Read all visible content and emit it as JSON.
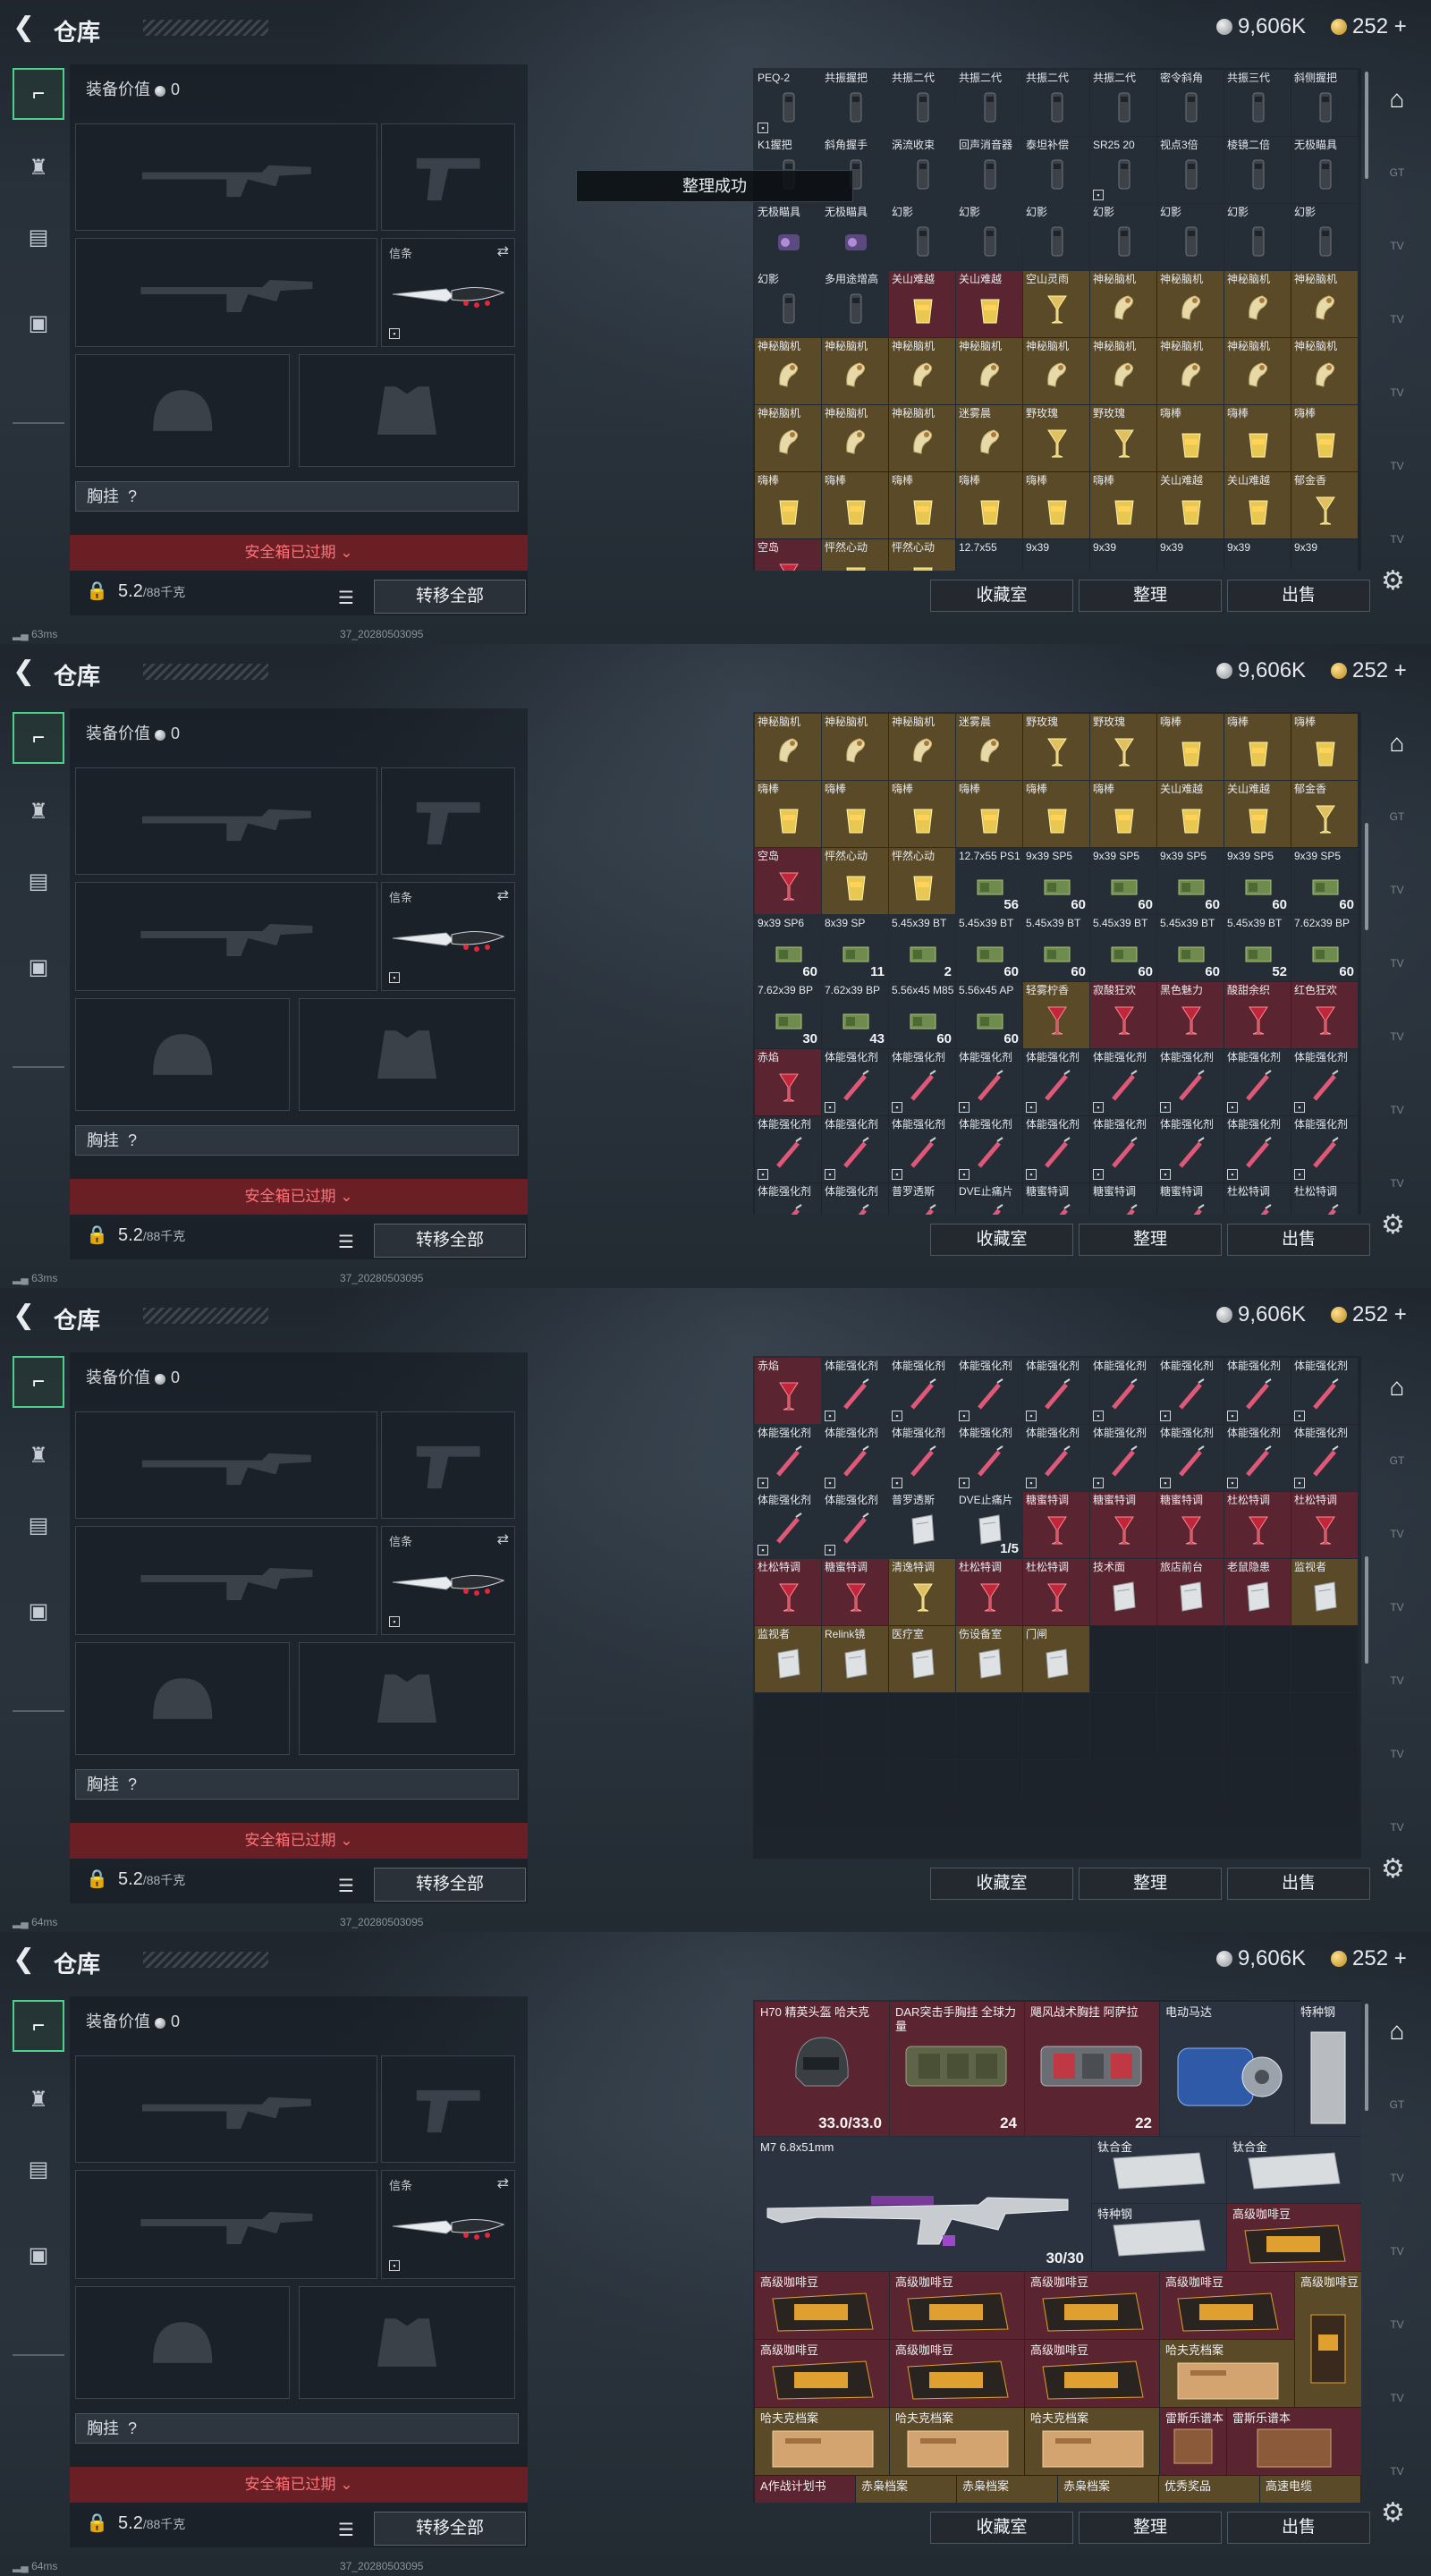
{
  "header": {
    "title": "仓库",
    "silver": "9,606K",
    "gold": "252"
  },
  "equip": {
    "value_label": "装备价值",
    "value": "0",
    "melee_label": "信条",
    "chest_label": "胸挂",
    "chest_value": "?",
    "safe_text": "安全箱已过期",
    "weight_value": "5.2",
    "weight_cap": "/88千克",
    "transfer_label": "转移全部"
  },
  "buttons": {
    "collection": "收藏室",
    "sort": "整理",
    "sell": "出售"
  },
  "toast": "整理成功",
  "status": {
    "ping1": "63ms",
    "ping2": "63ms",
    "ping3": "64ms",
    "ping4": "64ms",
    "ver": "37_20280503095"
  },
  "screens": [
    {
      "items": [
        {
          "n": "PEQ-2",
          "k": "att",
          "l": 1
        },
        {
          "n": "共振握把",
          "k": "att"
        },
        {
          "n": "共振二代",
          "k": "att"
        },
        {
          "n": "共振二代",
          "k": "att"
        },
        {
          "n": "共振二代",
          "k": "att"
        },
        {
          "n": "共振二代",
          "k": "att"
        },
        {
          "n": "密令斜角",
          "k": "att"
        },
        {
          "n": "共振三代",
          "k": "att"
        },
        {
          "n": "斜侧握把",
          "k": "att"
        },
        {
          "n": "K1握把",
          "k": "att"
        },
        {
          "n": "斜角握手",
          "k": "att"
        },
        {
          "n": "涡流收束",
          "k": "att"
        },
        {
          "n": "回声消音器",
          "k": "att"
        },
        {
          "n": "泰坦补偿",
          "k": "att"
        },
        {
          "n": "SR25 20",
          "k": "att",
          "l": 1
        },
        {
          "n": "视点3倍",
          "k": "att"
        },
        {
          "n": "棱镜二倍",
          "k": "att"
        },
        {
          "n": "无极瞄具",
          "k": "att"
        },
        {
          "n": "无极瞄具",
          "k": "pur"
        },
        {
          "n": "无极瞄具",
          "k": "pur"
        },
        {
          "n": "幻影",
          "k": "att"
        },
        {
          "n": "幻影",
          "k": "att"
        },
        {
          "n": "幻影",
          "k": "att"
        },
        {
          "n": "幻影",
          "k": "att"
        },
        {
          "n": "幻影",
          "k": "att"
        },
        {
          "n": "幻影",
          "k": "att"
        },
        {
          "n": "幻影",
          "k": "att"
        },
        {
          "n": "幻影",
          "k": "att"
        },
        {
          "n": "多用途增高",
          "k": "att"
        },
        {
          "n": "关山难越",
          "k": "drk",
          "b": "red"
        },
        {
          "n": "关山难越",
          "k": "drk",
          "b": "red"
        },
        {
          "n": "空山灵雨",
          "k": "cup",
          "b": "gold"
        },
        {
          "n": "神秘脑机",
          "k": "bio",
          "b": "gold"
        },
        {
          "n": "神秘脑机",
          "k": "bio",
          "b": "gold"
        },
        {
          "n": "神秘脑机",
          "k": "bio",
          "b": "gold"
        },
        {
          "n": "神秘脑机",
          "k": "bio",
          "b": "gold"
        },
        {
          "n": "神秘脑机",
          "k": "bio",
          "b": "gold"
        },
        {
          "n": "神秘脑机",
          "k": "bio",
          "b": "gold"
        },
        {
          "n": "神秘脑机",
          "k": "bio",
          "b": "gold"
        },
        {
          "n": "神秘脑机",
          "k": "bio",
          "b": "gold"
        },
        {
          "n": "神秘脑机",
          "k": "bio",
          "b": "gold"
        },
        {
          "n": "神秘脑机",
          "k": "bio",
          "b": "gold"
        },
        {
          "n": "神秘脑机",
          "k": "bio",
          "b": "gold"
        },
        {
          "n": "神秘脑机",
          "k": "bio",
          "b": "gold"
        },
        {
          "n": "神秘脑机",
          "k": "bio",
          "b": "gold"
        },
        {
          "n": "神秘脑机",
          "k": "bio",
          "b": "gold"
        },
        {
          "n": "神秘脑机",
          "k": "bio",
          "b": "gold"
        },
        {
          "n": "神秘脑机",
          "k": "bio",
          "b": "gold"
        },
        {
          "n": "迷雾晨",
          "k": "bio",
          "b": "gold"
        },
        {
          "n": "野玫瑰",
          "k": "cup",
          "b": "gold"
        },
        {
          "n": "野玫瑰",
          "k": "cup",
          "b": "gold"
        },
        {
          "n": "嗨棒",
          "k": "drk",
          "b": "gold"
        },
        {
          "n": "嗨棒",
          "k": "drk",
          "b": "gold"
        },
        {
          "n": "嗨棒",
          "k": "drk",
          "b": "gold"
        },
        {
          "n": "嗨棒",
          "k": "drk",
          "b": "gold"
        },
        {
          "n": "嗨棒",
          "k": "drk",
          "b": "gold"
        },
        {
          "n": "嗨棒",
          "k": "drk",
          "b": "gold"
        },
        {
          "n": "嗨棒",
          "k": "drk",
          "b": "gold"
        },
        {
          "n": "嗨棒",
          "k": "drk",
          "b": "gold"
        },
        {
          "n": "嗨棒",
          "k": "drk",
          "b": "gold"
        },
        {
          "n": "关山难越",
          "k": "drk",
          "b": "gold"
        },
        {
          "n": "关山难越",
          "k": "drk",
          "b": "gold"
        },
        {
          "n": "郁金香",
          "k": "cup",
          "b": "gold"
        },
        {
          "n": "空岛",
          "k": "red",
          "b": "red"
        },
        {
          "n": "怦然心动",
          "k": "drk",
          "b": "gold"
        },
        {
          "n": "怦然心动",
          "k": "drk",
          "b": "gold"
        },
        {
          "n": "12.7x55",
          "k": "amm"
        },
        {
          "n": "9x39",
          "k": "amm"
        },
        {
          "n": "9x39",
          "k": "amm"
        },
        {
          "n": "9x39",
          "k": "amm"
        },
        {
          "n": "9x39",
          "k": "amm"
        },
        {
          "n": "9x39",
          "k": "amm"
        }
      ]
    },
    {
      "items": [
        {
          "n": "神秘脑机",
          "k": "bio",
          "b": "gold"
        },
        {
          "n": "神秘脑机",
          "k": "bio",
          "b": "gold"
        },
        {
          "n": "神秘脑机",
          "k": "bio",
          "b": "gold"
        },
        {
          "n": "迷雾晨",
          "k": "bio",
          "b": "gold"
        },
        {
          "n": "野玫瑰",
          "k": "cup",
          "b": "gold"
        },
        {
          "n": "野玫瑰",
          "k": "cup",
          "b": "gold"
        },
        {
          "n": "嗨棒",
          "k": "drk",
          "b": "gold"
        },
        {
          "n": "嗨棒",
          "k": "drk",
          "b": "gold"
        },
        {
          "n": "嗨棒",
          "k": "drk",
          "b": "gold"
        },
        {
          "n": "嗨棒",
          "k": "drk",
          "b": "gold"
        },
        {
          "n": "嗨棒",
          "k": "drk",
          "b": "gold"
        },
        {
          "n": "嗨棒",
          "k": "drk",
          "b": "gold"
        },
        {
          "n": "嗨棒",
          "k": "drk",
          "b": "gold"
        },
        {
          "n": "嗨棒",
          "k": "drk",
          "b": "gold"
        },
        {
          "n": "嗨棒",
          "k": "drk",
          "b": "gold"
        },
        {
          "n": "关山难越",
          "k": "drk",
          "b": "gold"
        },
        {
          "n": "关山难越",
          "k": "drk",
          "b": "gold"
        },
        {
          "n": "郁金香",
          "k": "cup",
          "b": "gold"
        },
        {
          "n": "空岛",
          "k": "red",
          "b": "red"
        },
        {
          "n": "怦然心动",
          "k": "drk",
          "b": "gold"
        },
        {
          "n": "怦然心动",
          "k": "drk",
          "b": "gold"
        },
        {
          "n": "12.7x55 PS12A",
          "k": "amm",
          "c": "56"
        },
        {
          "n": "9x39 SP5",
          "k": "amm",
          "c": "60"
        },
        {
          "n": "9x39 SP5",
          "k": "amm",
          "c": "60"
        },
        {
          "n": "9x39 SP5",
          "k": "amm",
          "c": "60"
        },
        {
          "n": "9x39 SP5",
          "k": "amm",
          "c": "60"
        },
        {
          "n": "9x39 SP5",
          "k": "amm",
          "c": "60"
        },
        {
          "n": "9x39 SP6",
          "k": "amm",
          "c": "60"
        },
        {
          "n": "8x39 SP",
          "k": "amm",
          "c": "11"
        },
        {
          "n": "5.45x39 BT",
          "k": "amm",
          "c": "2"
        },
        {
          "n": "5.45x39 BT",
          "k": "amm",
          "c": "60"
        },
        {
          "n": "5.45x39 BT",
          "k": "amm",
          "c": "60"
        },
        {
          "n": "5.45x39 BT",
          "k": "amm",
          "c": "60"
        },
        {
          "n": "5.45x39 BT",
          "k": "amm",
          "c": "60"
        },
        {
          "n": "5.45x39 BT",
          "k": "amm",
          "c": "52"
        },
        {
          "n": "7.62x39 BP",
          "k": "amm",
          "c": "60"
        },
        {
          "n": "7.62x39 BP",
          "k": "amm",
          "c": "30"
        },
        {
          "n": "7.62x39 BP",
          "k": "amm",
          "c": "43"
        },
        {
          "n": "5.56x45 M855A1",
          "k": "amm",
          "c": "60"
        },
        {
          "n": "5.56x45 AP",
          "k": "amm",
          "c": "60"
        },
        {
          "n": "轻雾柠香",
          "k": "red",
          "b": "gold"
        },
        {
          "n": "寂酸狂欢",
          "k": "red",
          "b": "red"
        },
        {
          "n": "黑色魅力",
          "k": "red",
          "b": "red"
        },
        {
          "n": "酸甜余织",
          "k": "red",
          "b": "red"
        },
        {
          "n": "红色狂欢",
          "k": "red",
          "b": "red"
        },
        {
          "n": "赤焰",
          "k": "red",
          "b": "red"
        },
        {
          "n": "体能强化剂",
          "k": "syr"
        },
        {
          "n": "体能强化剂",
          "k": "syr"
        },
        {
          "n": "体能强化剂",
          "k": "syr"
        },
        {
          "n": "体能强化剂",
          "k": "syr"
        },
        {
          "n": "体能强化剂",
          "k": "syr"
        },
        {
          "n": "体能强化剂",
          "k": "syr"
        },
        {
          "n": "体能强化剂",
          "k": "syr"
        },
        {
          "n": "体能强化剂",
          "k": "syr"
        },
        {
          "n": "体能强化剂",
          "k": "syr"
        },
        {
          "n": "体能强化剂",
          "k": "syr"
        },
        {
          "n": "体能强化剂",
          "k": "syr"
        },
        {
          "n": "体能强化剂",
          "k": "syr"
        },
        {
          "n": "体能强化剂",
          "k": "syr"
        },
        {
          "n": "体能强化剂",
          "k": "syr"
        },
        {
          "n": "体能强化剂",
          "k": "syr"
        },
        {
          "n": "体能强化剂",
          "k": "syr"
        },
        {
          "n": "体能强化剂",
          "k": "syr"
        },
        {
          "n": "体能强化剂",
          "k": "syr"
        },
        {
          "n": "体能强化剂",
          "k": "syr"
        },
        {
          "n": "普罗透斯",
          "k": "syr"
        },
        {
          "n": "DVE止痛片",
          "k": "syr"
        },
        {
          "n": "糖蜜特调",
          "k": "syr"
        },
        {
          "n": "糖蜜特调",
          "k": "syr"
        },
        {
          "n": "糖蜜特调",
          "k": "syr"
        },
        {
          "n": "杜松特调",
          "k": "syr"
        },
        {
          "n": "杜松特调",
          "k": "syr"
        }
      ]
    },
    {
      "items": [
        {
          "n": "赤焰",
          "k": "red",
          "b": "red"
        },
        {
          "n": "体能强化剂",
          "k": "syr"
        },
        {
          "n": "体能强化剂",
          "k": "syr"
        },
        {
          "n": "体能强化剂",
          "k": "syr"
        },
        {
          "n": "体能强化剂",
          "k": "syr"
        },
        {
          "n": "体能强化剂",
          "k": "syr"
        },
        {
          "n": "体能强化剂",
          "k": "syr"
        },
        {
          "n": "体能强化剂",
          "k": "syr"
        },
        {
          "n": "体能强化剂",
          "k": "syr"
        },
        {
          "n": "体能强化剂",
          "k": "syr"
        },
        {
          "n": "体能强化剂",
          "k": "syr"
        },
        {
          "n": "体能强化剂",
          "k": "syr"
        },
        {
          "n": "体能强化剂",
          "k": "syr"
        },
        {
          "n": "体能强化剂",
          "k": "syr"
        },
        {
          "n": "体能强化剂",
          "k": "syr"
        },
        {
          "n": "体能强化剂",
          "k": "syr"
        },
        {
          "n": "体能强化剂",
          "k": "syr"
        },
        {
          "n": "体能强化剂",
          "k": "syr"
        },
        {
          "n": "体能强化剂",
          "k": "syr"
        },
        {
          "n": "体能强化剂",
          "k": "syr"
        },
        {
          "n": "普罗透斯",
          "k": "box"
        },
        {
          "n": "DVE止痛片",
          "k": "box",
          "c": "1/5"
        },
        {
          "n": "糖蜜特调",
          "k": "red",
          "b": "red"
        },
        {
          "n": "糖蜜特调",
          "k": "red",
          "b": "red"
        },
        {
          "n": "糖蜜特调",
          "k": "red",
          "b": "red"
        },
        {
          "n": "杜松特调",
          "k": "red",
          "b": "red"
        },
        {
          "n": "杜松特调",
          "k": "red",
          "b": "red"
        },
        {
          "n": "杜松特调",
          "k": "red",
          "b": "red"
        },
        {
          "n": "糖蜜特调",
          "k": "red",
          "b": "red"
        },
        {
          "n": "清逸特调",
          "k": "cup",
          "b": "gold"
        },
        {
          "n": "杜松特调",
          "k": "red",
          "b": "red"
        },
        {
          "n": "杜松特调",
          "k": "red",
          "b": "red"
        },
        {
          "n": "技术面",
          "k": "box",
          "b": "red"
        },
        {
          "n": "旅店前台",
          "k": "box",
          "b": "red"
        },
        {
          "n": "老鼠隐患",
          "k": "box",
          "b": "red"
        },
        {
          "n": "监视者",
          "k": "box",
          "b": "gold"
        },
        {
          "n": "监视者",
          "k": "box",
          "b": "gold"
        },
        {
          "n": "Relink镜",
          "k": "box",
          "b": "gold"
        },
        {
          "n": "医疗室",
          "k": "box",
          "b": "gold"
        },
        {
          "n": "伤设备室",
          "k": "box",
          "b": "gold"
        },
        {
          "n": "门闸",
          "k": "box",
          "b": "gold"
        },
        {
          "n": "",
          "k": "empty"
        },
        {
          "n": "",
          "k": "empty"
        },
        {
          "n": "",
          "k": "empty"
        },
        {
          "n": "",
          "k": "empty"
        },
        {
          "n": "",
          "k": "empty"
        },
        {
          "n": "",
          "k": "empty"
        },
        {
          "n": "",
          "k": "empty"
        },
        {
          "n": "",
          "k": "empty"
        },
        {
          "n": "",
          "k": "empty"
        },
        {
          "n": "",
          "k": "empty"
        },
        {
          "n": "",
          "k": "empty"
        },
        {
          "n": "",
          "k": "empty"
        },
        {
          "n": "",
          "k": "empty"
        },
        {
          "n": "",
          "k": "empty"
        },
        {
          "n": "",
          "k": "empty"
        },
        {
          "n": "",
          "k": "empty"
        },
        {
          "n": "",
          "k": "empty"
        },
        {
          "n": "",
          "k": "empty"
        },
        {
          "n": "",
          "k": "empty"
        },
        {
          "n": "",
          "k": "empty"
        },
        {
          "n": "",
          "k": "empty"
        },
        {
          "n": "",
          "k": "empty"
        }
      ]
    }
  ],
  "screen4": {
    "helmet": {
      "n": "H70 精英头盔 哈夫克",
      "c": "33.0/33.0"
    },
    "vest1": {
      "n": "DAR突击手胸挂 全球力量",
      "c": "24"
    },
    "vest2": {
      "n": "飓风战术胸挂 阿萨拉",
      "c": "22"
    },
    "motor": {
      "n": "电动马达"
    },
    "steel1": {
      "n": "特种钢"
    },
    "rifle": {
      "n": "M7 6.8x51mm",
      "c": "30/30"
    },
    "ti1": {
      "n": "钛合金"
    },
    "ti2": {
      "n": "钛合金"
    },
    "special": {
      "n": "特种钢"
    },
    "coffee": {
      "n": "高级咖啡豆"
    },
    "file": {
      "n": "哈夫克档案"
    },
    "bottom_row": [
      "A作战计划书",
      "赤枭档案",
      "赤枭档案",
      "赤枭档案",
      "优秀奖品",
      "高速电缆"
    ],
    "misc1": "雷斯乐谱本",
    "misc2": "雷斯乐谱本"
  }
}
